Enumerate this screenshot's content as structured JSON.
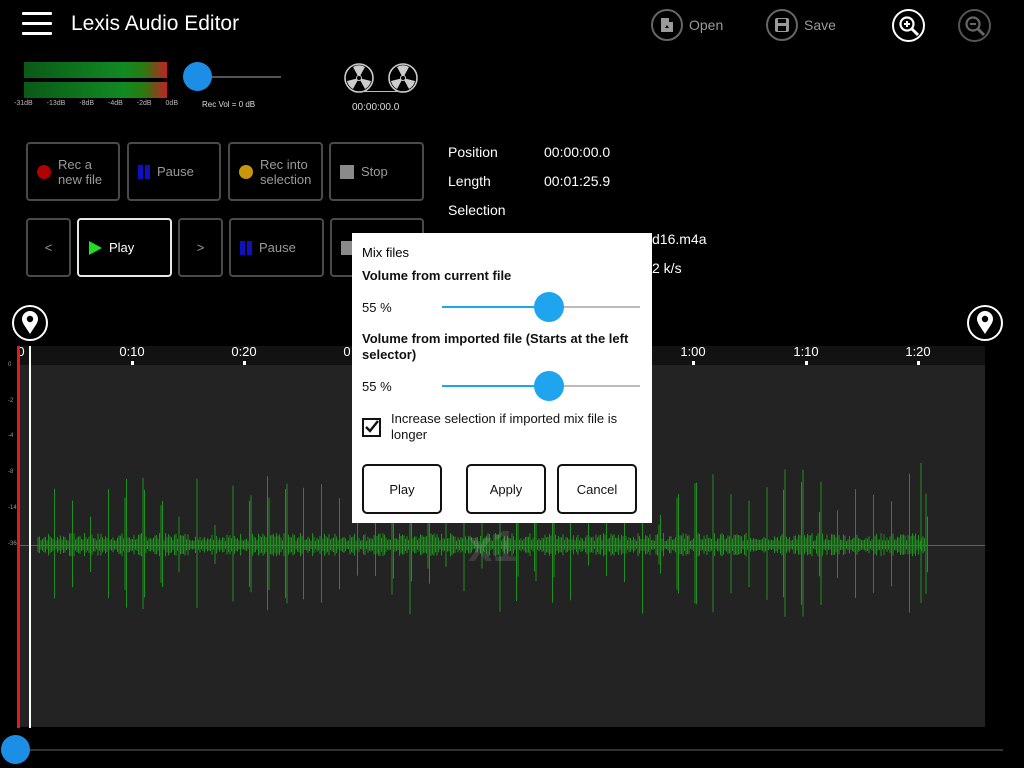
{
  "app": {
    "title": "Lexis Audio Editor"
  },
  "toolbar": {
    "open_label": "Open",
    "save_label": "Save"
  },
  "meter": {
    "ticks": [
      "-31dB",
      "-13dB",
      "-8dB",
      "-4dB",
      "-2dB",
      "0dB"
    ],
    "rec_vol_label": "Rec Vol = 0 dB",
    "time": "00:00:00.0"
  },
  "controls": {
    "rec_new": "Rec a new file",
    "pause1": "Pause",
    "rec_into": "Rec into selection",
    "stop": "Stop",
    "prev": "<",
    "play": "Play",
    "next": ">",
    "pause2": "Pause"
  },
  "info": {
    "position_key": "Position",
    "position_val": "00:00:00.0",
    "length_key": "Length",
    "length_val": "00:01:25.9",
    "selection_key": "Selection",
    "file_val": "d16.m4a",
    "bitrate_val": "2 k/s"
  },
  "timeline": {
    "ticks": [
      "0",
      "0:10",
      "0:20",
      "0",
      "1:00",
      "1:10",
      "1:20"
    ],
    "db_labels": [
      "0",
      "-2",
      "-4",
      "-8",
      "-14",
      "-36"
    ],
    "zoom": "x1"
  },
  "dialog": {
    "title": "Mix files",
    "vol_current_label": "Volume from current file",
    "vol_current_pct": "55 %",
    "vol_current_value": 55,
    "vol_imported_label": "Volume from imported file (Starts at the left selector)",
    "vol_imported_pct": "55 %",
    "vol_imported_value": 55,
    "checkbox_label": "Increase selection if imported mix file is longer",
    "checkbox_checked": true,
    "play_label": "Play",
    "apply_label": "Apply",
    "cancel_label": "Cancel"
  },
  "colors": {
    "accent": "#1c8ee6",
    "waveform": "#1f8f1f",
    "cursor": "#e21a1a",
    "record": "#b00000",
    "rec_into": "#c8960a",
    "play": "#22dd22",
    "pause": "#1010c0"
  },
  "icons": {
    "menu": "hamburger-icon",
    "open": "open-file-icon",
    "save": "save-floppy-icon",
    "zoom_in": "zoom-in-icon",
    "zoom_out": "zoom-out-icon",
    "reel": "tape-reel-icon",
    "marker": "location-pin-icon"
  }
}
